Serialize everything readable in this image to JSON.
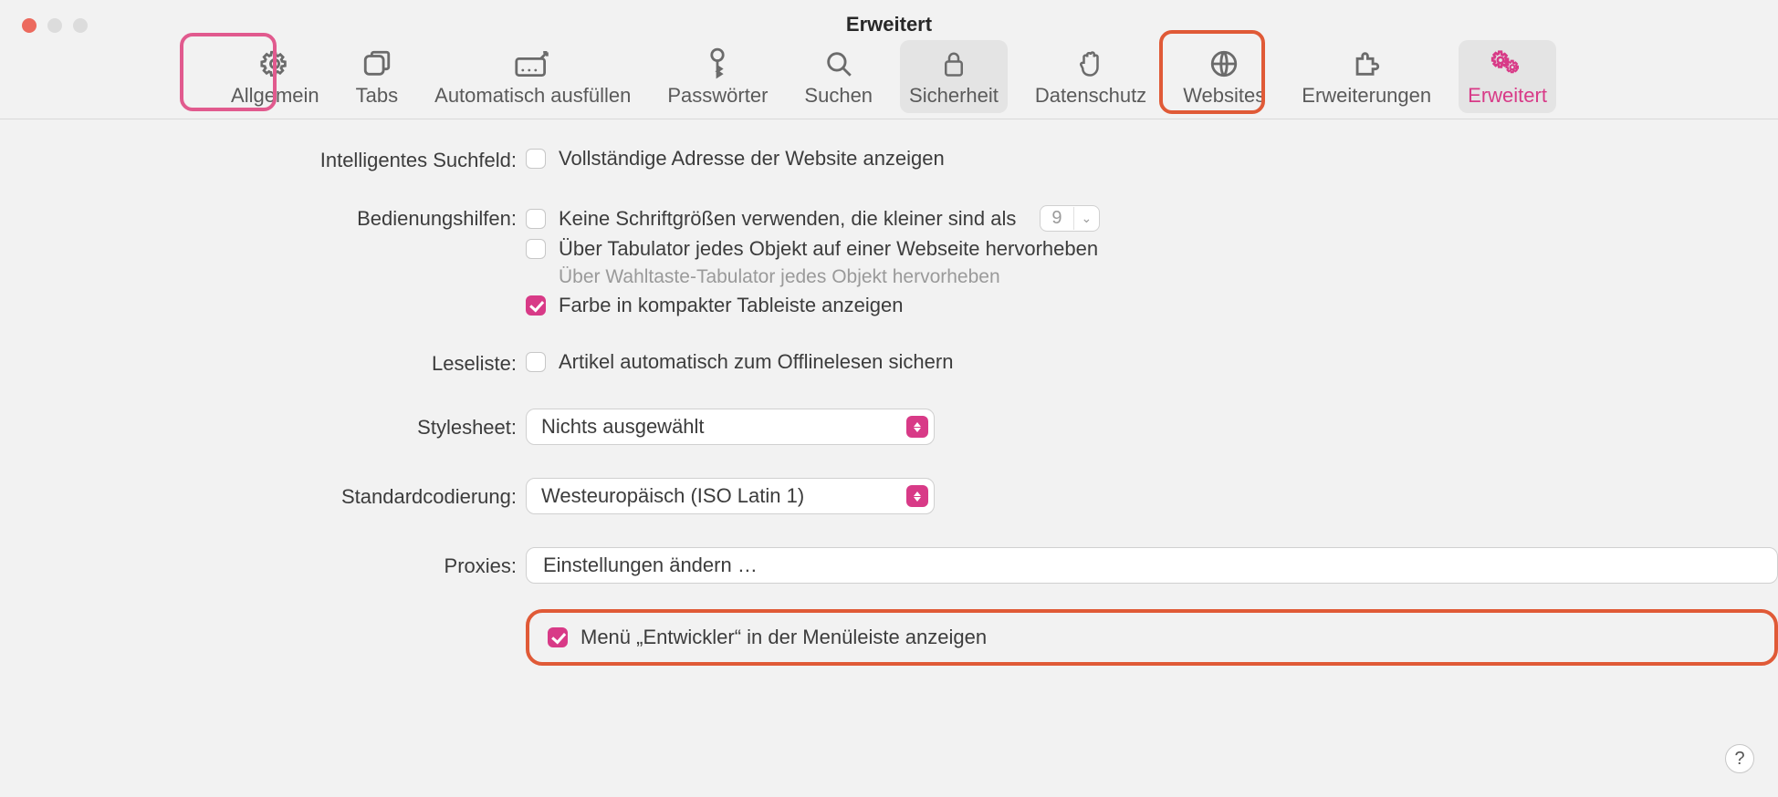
{
  "window": {
    "title": "Erweitert"
  },
  "toolbar": {
    "general": {
      "label": "Allgemein"
    },
    "tabs": {
      "label": "Tabs"
    },
    "autofill": {
      "label": "Automatisch ausfüllen"
    },
    "passwords": {
      "label": "Passwörter"
    },
    "search": {
      "label": "Suchen"
    },
    "security": {
      "label": "Sicherheit"
    },
    "privacy": {
      "label": "Datenschutz"
    },
    "websites": {
      "label": "Websites"
    },
    "extensions": {
      "label": "Erweiterungen"
    },
    "advanced": {
      "label": "Erweitert"
    }
  },
  "sections": {
    "smartsearch": {
      "label": "Intelligentes Suchfeld:",
      "fulladdr": "Vollständige Adresse der Website anzeigen"
    },
    "accessibility": {
      "label": "Bedienungshilfen:",
      "minfont": "Keine Schriftgrößen verwenden, die kleiner sind als",
      "minfont_value": "9",
      "tab": "Über Tabulator jedes Objekt auf einer Webseite hervorheben",
      "tab_hint": "Über Wahltaste-Tabulator jedes Objekt hervorheben",
      "compactcolor": "Farbe in kompakter Tableiste anzeigen"
    },
    "readinglist": {
      "label": "Leseliste:",
      "offline": "Artikel automatisch zum Offlinelesen sichern"
    },
    "stylesheet": {
      "label": "Stylesheet:",
      "value": "Nichts ausgewählt"
    },
    "encoding": {
      "label": "Standardcodierung:",
      "value": "Westeuropäisch (ISO Latin 1)"
    },
    "proxies": {
      "label": "Proxies:",
      "button": "Einstellungen ändern …"
    },
    "devmenu": {
      "label": "Menü „Entwickler“ in der Menüleiste anzeigen"
    }
  },
  "help": "?"
}
